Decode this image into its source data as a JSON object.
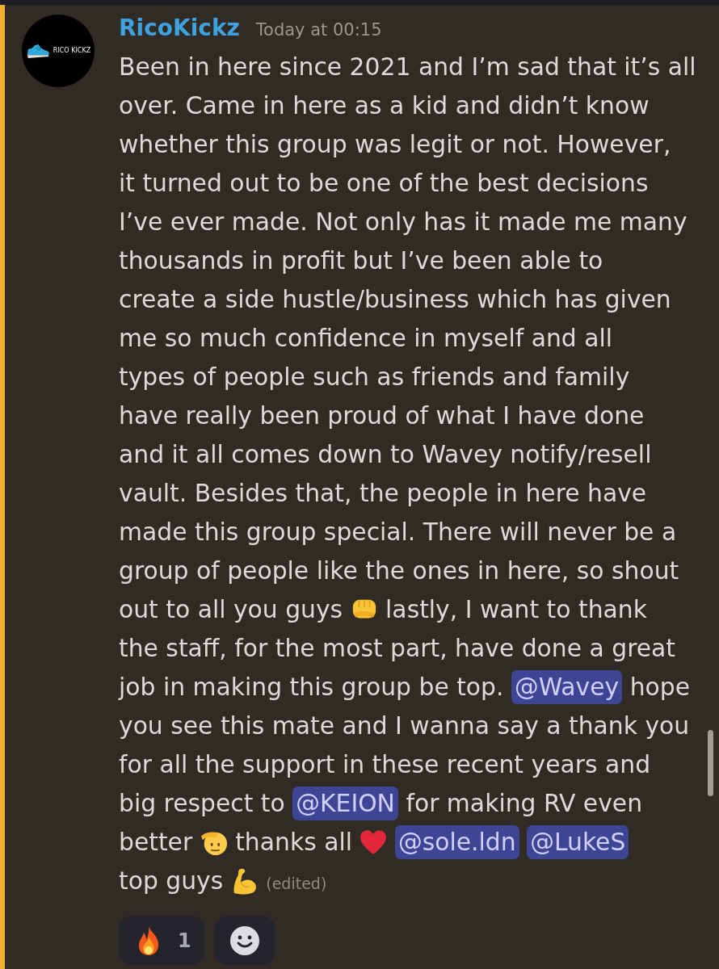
{
  "message": {
    "highlighted": true,
    "avatar": {
      "logo_text": "RICO KICKZ"
    },
    "author": "RicoKickz",
    "timestamp": "Today at 00:15",
    "lines": [
      [
        {
          "kind": "text",
          "text": "Been in here since 2021 and I’m sad that it’s all"
        }
      ],
      [
        {
          "kind": "text",
          "text": "over. Came in here as a kid and didn’t know"
        }
      ],
      [
        {
          "kind": "text",
          "text": "whether this group was legit or not. However,"
        }
      ],
      [
        {
          "kind": "text",
          "text": "it turned out to be one of the best decisions"
        }
      ],
      [
        {
          "kind": "text",
          "text": "I’ve ever made. Not only has it made me many"
        }
      ],
      [
        {
          "kind": "text",
          "text": "thousands in profit but I’ve been able to"
        }
      ],
      [
        {
          "kind": "text",
          "text": "create a side hustle/business which has given"
        }
      ],
      [
        {
          "kind": "text",
          "text": "me so much confidence in myself and all"
        }
      ],
      [
        {
          "kind": "text",
          "text": "types of people such as friends and family"
        }
      ],
      [
        {
          "kind": "text",
          "text": "have really been proud of what I have done"
        }
      ],
      [
        {
          "kind": "text",
          "text": "and it all comes down to Wavey notify/resell"
        }
      ],
      [
        {
          "kind": "text",
          "text": "vault. Besides that, the people in here have"
        }
      ],
      [
        {
          "kind": "text",
          "text": "made this group special. There will never be a"
        }
      ],
      [
        {
          "kind": "text",
          "text": "group of people like the ones in here, so shout"
        }
      ],
      [
        {
          "kind": "text",
          "text": "out to all you guys"
        },
        {
          "kind": "fist"
        },
        {
          "kind": "text",
          "text": "lastly, I want to thank"
        }
      ],
      [
        {
          "kind": "text",
          "text": "the staff, for the most part, have done a great"
        }
      ],
      [
        {
          "kind": "text",
          "text": "job in making this group be top."
        },
        {
          "kind": "mention",
          "text": "@Wavey"
        },
        {
          "kind": "text",
          "text": "hope"
        }
      ],
      [
        {
          "kind": "text",
          "text": "you see this mate and I wanna say a thank you"
        }
      ],
      [
        {
          "kind": "text",
          "text": "for all the support in these recent years and"
        }
      ],
      [
        {
          "kind": "text",
          "text": "big respect to"
        },
        {
          "kind": "mention",
          "text": "@KEION"
        },
        {
          "kind": "text",
          "text": "for making RV even"
        }
      ],
      [
        {
          "kind": "text",
          "text": "better"
        },
        {
          "kind": "salute"
        },
        {
          "kind": "text",
          "text": "thanks all"
        },
        {
          "kind": "heart"
        },
        {
          "kind": "mention",
          "text": "@sole.ldn"
        },
        {
          "kind": "mention",
          "text": "@LukeS"
        }
      ],
      [
        {
          "kind": "text",
          "text": "top guys"
        },
        {
          "kind": "muscle"
        }
      ]
    ],
    "edited": "(edited)"
  },
  "reactions": [
    {
      "kind": "fire",
      "count": "1"
    }
  ]
}
